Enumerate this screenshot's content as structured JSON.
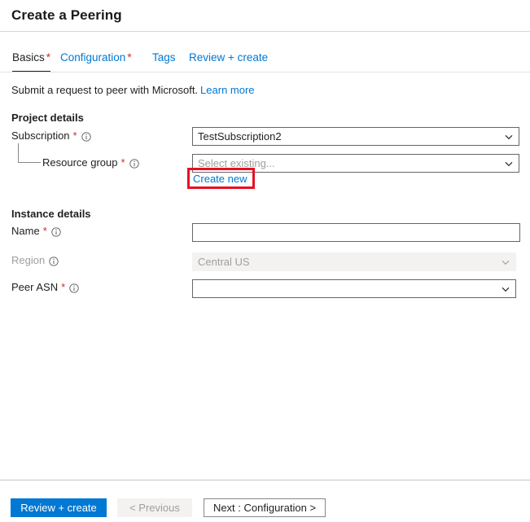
{
  "header": {
    "title": "Create a Peering"
  },
  "tabs": [
    {
      "id": "basics",
      "label": "Basics",
      "required": "*",
      "active": true
    },
    {
      "id": "configuration",
      "label": "Configuration",
      "required": "*",
      "active": false
    },
    {
      "id": "tags",
      "label": "Tags",
      "required": "",
      "active": false
    },
    {
      "id": "review",
      "label": "Review + create",
      "required": "",
      "active": false
    }
  ],
  "intro": {
    "text": "Submit a request to peer with Microsoft.",
    "link_label": "Learn more"
  },
  "sections": {
    "project_details": {
      "title": "Project details",
      "fields": {
        "subscription": {
          "label": "Subscription",
          "required": "*",
          "info_icon": "info-circle-icon",
          "value": "TestSubscription2",
          "chevron_icon": "chevron-down-icon",
          "disabled": false
        },
        "resource_group": {
          "label": "Resource group",
          "required": "*",
          "info_icon": "info-circle-icon",
          "placeholder": "Select existing...",
          "value": "",
          "chevron_icon": "chevron-down-icon",
          "create_new_label": "Create new",
          "disabled": false
        }
      }
    },
    "instance_details": {
      "title": "Instance details",
      "fields": {
        "name": {
          "label": "Name",
          "required": "*",
          "info_icon": "info-circle-icon",
          "value": "",
          "disabled": false
        },
        "region": {
          "label": "Region",
          "required": "",
          "info_icon": "info-circle-icon",
          "value": "Central US",
          "chevron_icon": "chevron-down-icon",
          "disabled": true
        },
        "peer_asn": {
          "label": "Peer ASN",
          "required": "*",
          "info_icon": "info-circle-icon",
          "value": "",
          "chevron_icon": "chevron-down-icon",
          "disabled": false
        }
      }
    }
  },
  "annotation": {
    "target": "create-new-link",
    "color": "#e81123"
  },
  "footer": {
    "review_create_label": "Review + create",
    "previous_label": "< Previous",
    "next_label": "Next : Configuration >"
  },
  "colors": {
    "accent": "#0078d4",
    "required_asterisk": "#c4332c",
    "annotation_red": "#e81123",
    "disabled_text": "#a19f9d",
    "disabled_bg": "#f3f2f1"
  }
}
